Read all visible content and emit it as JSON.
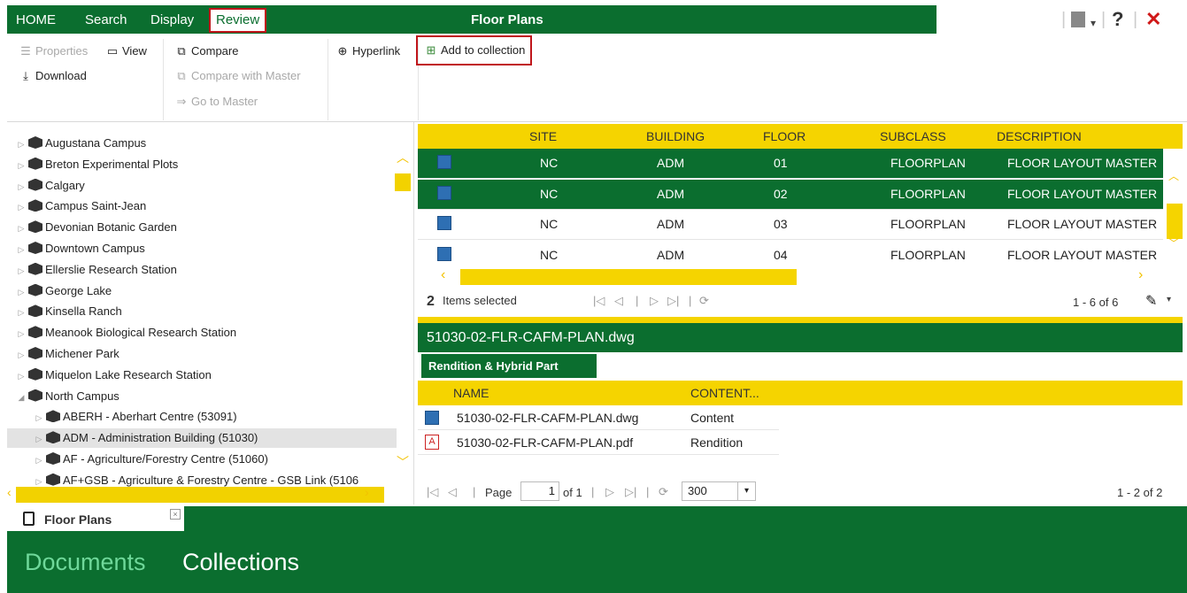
{
  "tabs": {
    "home": "HOME",
    "search": "Search",
    "display": "Display",
    "review": "Review"
  },
  "app_title": "Floor Plans",
  "topright": {
    "help": "?",
    "close": "✕"
  },
  "ribbon": {
    "properties": "Properties",
    "view": "View",
    "download": "Download",
    "compare": "Compare",
    "compare_master": "Compare with Master",
    "go_master": "Go to Master",
    "hyperlink": "Hyperlink",
    "add_collection": "Add to collection"
  },
  "tree": {
    "top_nodes": [
      "Augustana Campus",
      "Breton Experimental Plots",
      "Calgary",
      "Campus Saint-Jean",
      "Devonian Botanic Garden",
      "Downtown Campus",
      "Ellerslie Research Station",
      "George Lake",
      "Kinsella Ranch",
      "Meanook Biological Research Station",
      "Michener Park",
      "Miquelon Lake Research Station",
      "North Campus"
    ],
    "children": [
      "ABERH - Aberhart Centre (53091)",
      "ADM - Administration Building (51030)",
      "AF - Agriculture/Forestry Centre (51060)",
      "AF+GSB - Agriculture & Forestry Centre - GSB Link (5106"
    ]
  },
  "grid": {
    "columns": [
      "SITE",
      "BUILDING",
      "FLOOR",
      "SUBCLASS",
      "DESCRIPTION"
    ],
    "rows": [
      {
        "site": "NC",
        "building": "ADM",
        "floor": "01",
        "subclass": "FLOORPLAN",
        "description": "FLOOR LAYOUT MASTER",
        "selected": true
      },
      {
        "site": "NC",
        "building": "ADM",
        "floor": "02",
        "subclass": "FLOORPLAN",
        "description": "FLOOR LAYOUT MASTER",
        "selected": true
      },
      {
        "site": "NC",
        "building": "ADM",
        "floor": "03",
        "subclass": "FLOORPLAN",
        "description": "FLOOR LAYOUT MASTER",
        "selected": false
      },
      {
        "site": "NC",
        "building": "ADM",
        "floor": "04",
        "subclass": "FLOORPLAN",
        "description": "FLOOR LAYOUT MASTER",
        "selected": false
      }
    ]
  },
  "pager1": {
    "selected_count": "2",
    "selected_label": "Items selected",
    "range": "1 - 6 of 6"
  },
  "file": {
    "name": "51030-02-FLR-CAFM-PLAN.dwg"
  },
  "rendition": {
    "tab": "Rendition & Hybrid Part",
    "columns": [
      "NAME",
      "CONTENT..."
    ],
    "rows": [
      {
        "name": "51030-02-FLR-CAFM-PLAN.dwg",
        "content": "Content"
      },
      {
        "name": "51030-02-FLR-CAFM-PLAN.pdf",
        "content": "Rendition"
      }
    ]
  },
  "pager2": {
    "page_label": "Page",
    "page_value": "1",
    "of": "of 1",
    "page_size": "300",
    "range": "1 - 2 of 2"
  },
  "bottom": {
    "tab": "Floor Plans",
    "documents": "Documents",
    "collections": "Collections"
  },
  "colors": {
    "green": "#0b6e2f",
    "yellow": "#f5d400",
    "highlight": "#c0161b"
  }
}
